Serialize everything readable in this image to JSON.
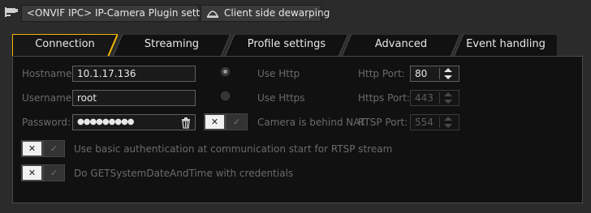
{
  "toolbar": {
    "plugin_settings_label": "<ONVIF IPC> IP-Camera Plugin settings",
    "dewarping_label": "Client side dewarping"
  },
  "tabs": [
    {
      "label": "Connection",
      "active": true
    },
    {
      "label": "Streaming",
      "active": false
    },
    {
      "label": "Profile settings",
      "active": false
    },
    {
      "label": "Advanced",
      "active": false
    },
    {
      "label": "Event handling",
      "active": false
    }
  ],
  "form": {
    "hostname_label": "Hostname:",
    "hostname_value": "10.1.17.136",
    "username_label": "Username:",
    "username_value": "root",
    "password_label": "Password:",
    "password_value": "●●●●●●●●●",
    "use_http_label": "Use Http",
    "use_https_label": "Use Https",
    "nat_label": "Camera is behind NAT",
    "http_port_label": "Http Port:",
    "http_port_value": "80",
    "https_port_label": "Https Port:",
    "https_port_value": "443",
    "rtsp_port_label": "RTSP Port:",
    "rtsp_port_value": "554",
    "basic_auth_label": "Use basic authentication at communication start for RTSP stream",
    "getdatetime_label": "Do GETSystemDateAndTime with credentials"
  },
  "colors": {
    "accent": "#f0b400",
    "panel_bg": "#111111",
    "window_bg": "#2b2b2b"
  }
}
